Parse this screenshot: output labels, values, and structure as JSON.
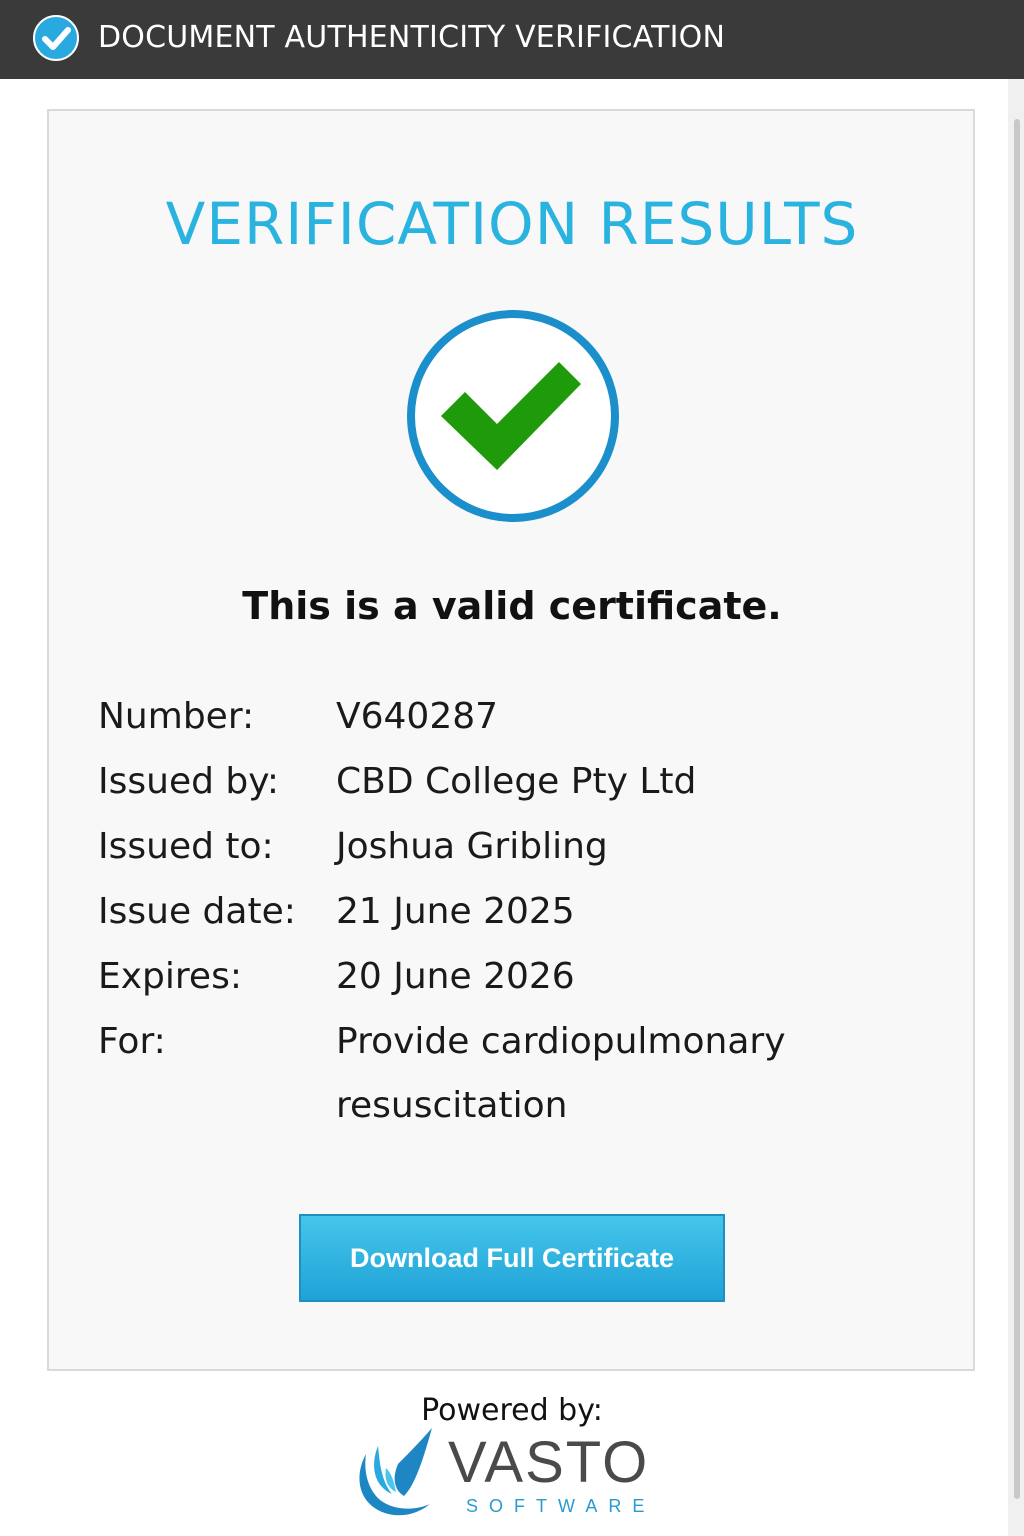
{
  "header": {
    "title": "DOCUMENT AUTHENTICITY VERIFICATION",
    "icon": "check-badge-icon"
  },
  "main": {
    "results_title": "VERIFICATION RESULTS",
    "status_icon": "checkmark-circle-icon",
    "status_message": "This is a valid certificate.",
    "details": [
      {
        "label": "Number:",
        "value": "V640287"
      },
      {
        "label": "Issued by:",
        "value": "CBD College Pty Ltd"
      },
      {
        "label": "Issued to:",
        "value": "Joshua Gribling"
      },
      {
        "label": "Issue date:",
        "value": "21 June 2025"
      },
      {
        "label": "Expires:",
        "value": "20 June 2026"
      },
      {
        "label": "For:",
        "value": "Provide cardiopulmonary resuscitation"
      }
    ],
    "download_label": "Download Full Certificate"
  },
  "footer": {
    "powered_by": "Powered by:",
    "logo_name": "VASTO",
    "logo_sub": "SOFTWARE"
  },
  "colors": {
    "accent": "#2bb3e0",
    "check_green": "#1e9a0a",
    "circle_blue": "#1a8fcc",
    "header_bg": "#3a3a3a"
  }
}
